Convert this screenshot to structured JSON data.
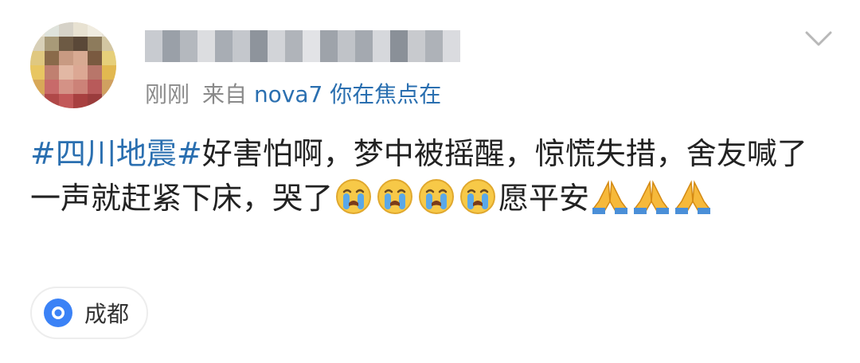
{
  "post": {
    "meta": {
      "time": "刚刚",
      "source_prefix": "来自",
      "source": "nova7 你在焦点在"
    },
    "hashtag": "#四川地震#",
    "text_1": "好害怕啊，梦中被摇醒，惊慌失措，舍友喊了一声就赶紧下床，哭了",
    "text_2": "愿平安",
    "emojis_after_text_1": [
      "loudly-crying-face-icon",
      "loudly-crying-face-icon",
      "loudly-crying-face-icon",
      "loudly-crying-face-icon"
    ],
    "emojis_end": [
      "folded-hands-icon",
      "folded-hands-icon",
      "folded-hands-icon"
    ],
    "location": "成都"
  },
  "colors": {
    "link": "#2a6fb0",
    "meta_gray": "#8a8a8a",
    "location_pin": "#3b82f6"
  }
}
